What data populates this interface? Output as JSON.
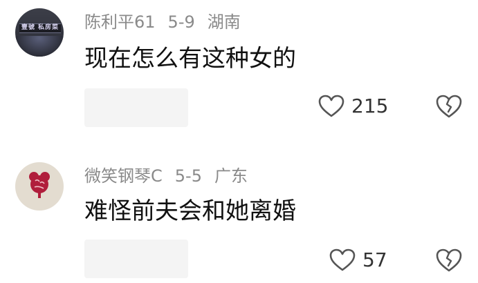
{
  "comments": [
    {
      "username": "陈利平61",
      "date": "5-9",
      "location": "湖南",
      "avatar_text": "壹號 私房菜",
      "text": "现在怎么有这种女的",
      "likes": "215",
      "like_icon": "heart-outline-icon",
      "dislike_icon": "broken-heart-icon"
    },
    {
      "username": "微笑钢琴C",
      "date": "5-5",
      "location": "广东",
      "text": "难怪前夫会和她离婚",
      "likes": "57",
      "like_icon": "heart-outline-icon",
      "dislike_icon": "broken-heart-icon"
    }
  ]
}
